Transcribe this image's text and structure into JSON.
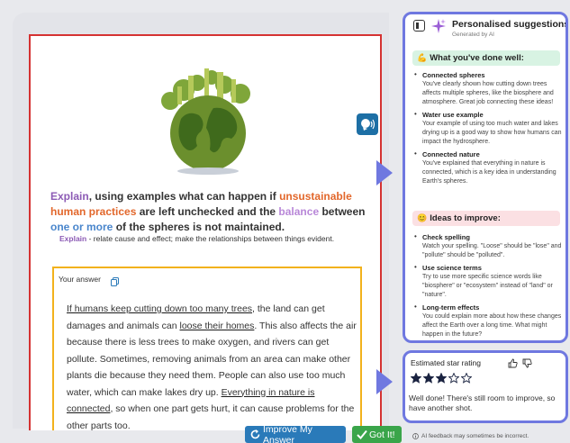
{
  "question": {
    "parts": [
      {
        "text": "Explain",
        "style": "kw-explain"
      },
      {
        "text": ", using examples what can happen if ",
        "style": ""
      },
      {
        "text": "unsustainable human practices",
        "style": "kw-unsust"
      },
      {
        "text": " are left unchecked and the ",
        "style": ""
      },
      {
        "text": "balance",
        "style": "kw-balance"
      },
      {
        "text": " between ",
        "style": ""
      },
      {
        "text": "one or more",
        "style": "kw-onemore"
      },
      {
        "text": " of the spheres is not maintained.",
        "style": ""
      }
    ]
  },
  "hint": {
    "key": "Explain",
    "text": " - relate cause and effect; make the relationships between things evident."
  },
  "answer": {
    "label": "Your answer",
    "parts": [
      {
        "text": "If humans keep cutting down too many trees",
        "style": "ul-spell"
      },
      {
        "text": ", the land can get damages and animals can ",
        "style": ""
      },
      {
        "text": "loose their homes",
        "style": "ul-spell"
      },
      {
        "text": ". This also affects the air because there is less trees to make oxygen, and rivers can get pollute. Sometimes, removing animals from an area can make other plants die because they need them. People can also use too much water, which can make lakes dry up. ",
        "style": ""
      },
      {
        "text": "Everything in nature is connected",
        "style": "ul-spell"
      },
      {
        "text": ", so when one part gets hurt, it can cause problems for the other parts too.",
        "style": ""
      }
    ]
  },
  "buttons": {
    "improve": "Improve My Answer",
    "got_it": "Got It!"
  },
  "suggestions": {
    "title": "Personalised suggestions",
    "subtitle": "Generated by AI",
    "done_well": {
      "emoji": "💪",
      "heading": "What you've done well:",
      "items": [
        {
          "title": "Connected spheres",
          "body": "You've clearly shown how cutting down trees affects multiple spheres, like the biosphere and atmosphere. Great job connecting these ideas!"
        },
        {
          "title": "Water use example",
          "body": "Your example of using too much water and lakes drying up is a good way to show how humans can impact the hydrosphere."
        },
        {
          "title": "Connected nature",
          "body": "You've explained that everything in nature is connected, which is a key idea in understanding Earth's spheres."
        }
      ]
    },
    "to_improve": {
      "emoji": "😊",
      "heading": "Ideas to improve:",
      "items": [
        {
          "title": "Check spelling",
          "body": "Watch your spelling. \"Loose\" should be \"lose\" and \"pollute\" should be \"polluted\"."
        },
        {
          "title": "Use science terms",
          "body": "Try to use more specific science words like \"biosphere\" or \"ecosystem\" instead of \"land\" or \"nature\"."
        },
        {
          "title": "Long-term effects",
          "body": "You could explain more about how these changes affect the Earth over a long time. What might happen in the future?"
        }
      ]
    }
  },
  "rating": {
    "label": "Estimated star rating",
    "stars_filled": 3,
    "stars_total": 5,
    "message": "Well done! There's still room to improve, so have another shot."
  },
  "disclaimer": "AI feedback may sometimes be incorrect.",
  "colors": {
    "accent": "#6f78e0",
    "worksheet_border": "#d53232",
    "answer_border": "#f2b21c",
    "improve_button": "#2a7ab9",
    "got_it_button": "#3aa54a"
  }
}
